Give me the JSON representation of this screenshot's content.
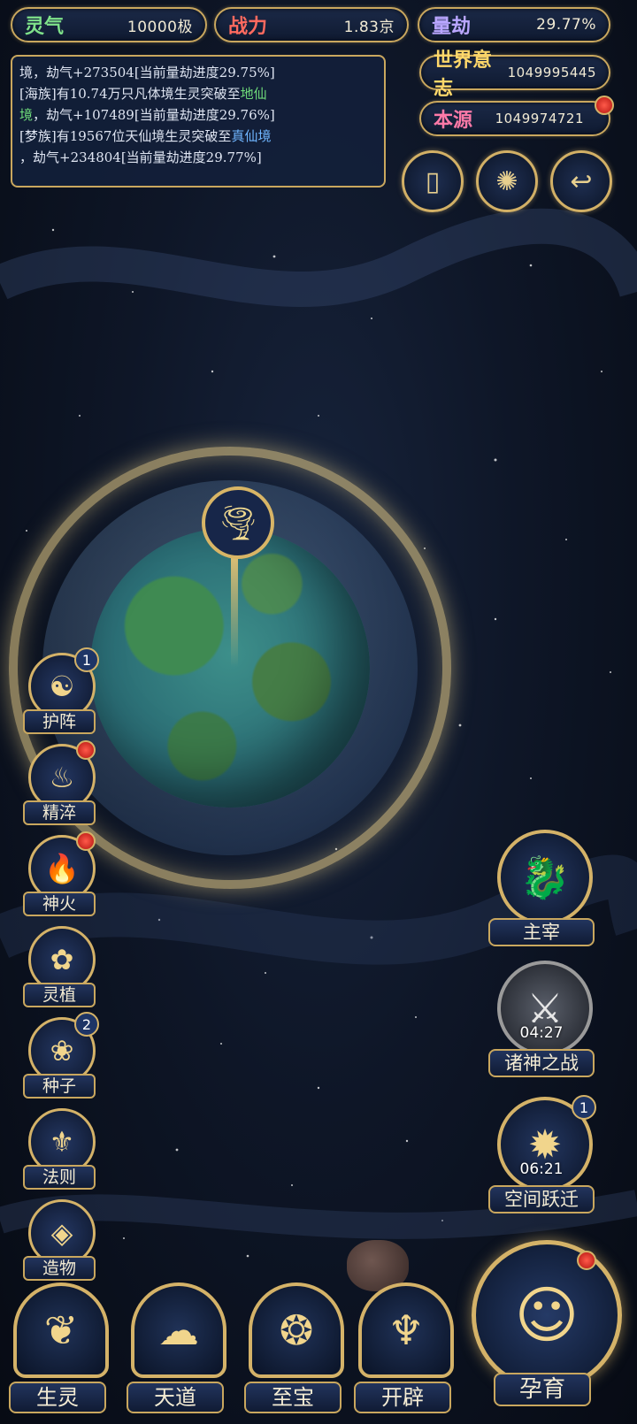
{
  "stats": {
    "lingqi": {
      "label": "灵气",
      "value": "10000极",
      "color": "#7fe28a"
    },
    "zhanli": {
      "label": "战力",
      "value": "1.83京",
      "color": "#ff6a5f"
    },
    "liangjie": {
      "label": "量劫",
      "value": "29.77%",
      "color": "#b9a6ff"
    },
    "shijie": {
      "label": "世界意志",
      "value": "1049995445",
      "color": "#ffd86a"
    },
    "benyuan": {
      "label": "本源",
      "value": "1049974721",
      "color": "#ff7aa8"
    }
  },
  "log": {
    "lines": [
      {
        "pre": "境，劫气+273504[当前量劫进度29.75%]",
        "hl": "",
        "post": ""
      },
      {
        "pre": "[海族]有10.74万只凡体境生灵突破至",
        "hl": "地仙",
        "post": ""
      },
      {
        "pre": "",
        "hl": "境",
        "post": "，劫气+107489[当前量劫进度29.76%]"
      },
      {
        "pre": "[梦族]有19567位天仙境生灵突破至",
        "hl": "真仙境",
        "post": ""
      },
      {
        "pre": "，劫气+234804[当前量劫进度29.77%]",
        "hl": "",
        "post": ""
      }
    ]
  },
  "top_buttons": [
    {
      "name": "card-icon",
      "glyph": "▯"
    },
    {
      "name": "vortex-icon",
      "glyph": "✺"
    },
    {
      "name": "scroll-icon",
      "glyph": "↩"
    }
  ],
  "planet": {
    "pin_icon": "tornado-icon",
    "pin_glyph": "🌪"
  },
  "left_menu": [
    {
      "id": "huzhen",
      "label": "护阵",
      "icon": "yin-yang-icon",
      "glyph": "☯",
      "badge": "1"
    },
    {
      "id": "jingcui",
      "label": "精淬",
      "icon": "lotus-flame-icon",
      "glyph": "♨",
      "dot": true
    },
    {
      "id": "shenhuo",
      "label": "神火",
      "icon": "divine-fire-icon",
      "glyph": "🔥",
      "dot": true
    },
    {
      "id": "lingzhi",
      "label": "灵植",
      "icon": "spirit-plant-icon",
      "glyph": "✿"
    },
    {
      "id": "zhongzi",
      "label": "种子",
      "icon": "seed-icon",
      "glyph": "❀",
      "badge": "2"
    },
    {
      "id": "faze",
      "label": "法则",
      "icon": "law-icon",
      "glyph": "⚜"
    },
    {
      "id": "zaowu",
      "label": "造物",
      "icon": "creation-icon",
      "glyph": "◈"
    }
  ],
  "right_menu": [
    {
      "id": "zhuzai",
      "label": "主宰",
      "icon": "dragon-icon",
      "glyph": "🐉"
    },
    {
      "id": "zhushen",
      "label": "诸神之战",
      "icon": "sword-icon",
      "glyph": "⚔",
      "timer": "04:27"
    },
    {
      "id": "kongjian",
      "label": "空间跃迁",
      "icon": "space-jump-icon",
      "glyph": "✹",
      "timer": "06:21",
      "badge": "1"
    }
  ],
  "bottom_menu": [
    {
      "id": "shengling",
      "label": "生灵",
      "icon": "creature-icon",
      "glyph": "❦"
    },
    {
      "id": "tiandao",
      "label": "天道",
      "icon": "heaven-way-icon",
      "glyph": "☁"
    },
    {
      "id": "zhibao",
      "label": "至宝",
      "icon": "treasure-icon",
      "glyph": "❂"
    },
    {
      "id": "kaipi",
      "label": "开辟",
      "icon": "creation-fire-icon",
      "glyph": "♆"
    }
  ],
  "big_button": {
    "label": "孕育",
    "icon": "nurture-icon",
    "glyph": "☺",
    "dot": true
  }
}
